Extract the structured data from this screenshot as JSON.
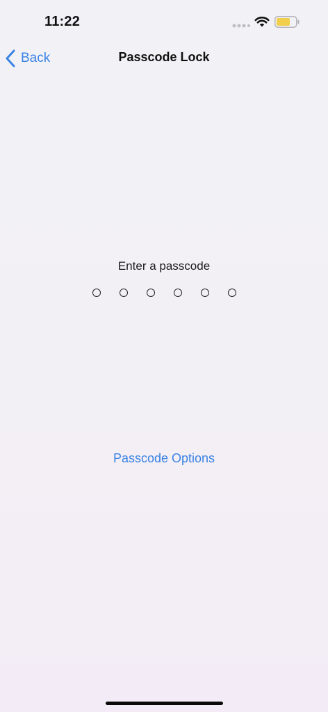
{
  "status_bar": {
    "time": "11:22",
    "icons": {
      "signal": "cellular-signal-icon",
      "wifi": "wifi-icon",
      "battery": "battery-icon"
    },
    "battery_color": "#f2cf4a"
  },
  "nav": {
    "back_label": "Back",
    "back_icon": "chevron-left-icon",
    "title": "Passcode Lock"
  },
  "passcode": {
    "prompt": "Enter a passcode",
    "digits": 6,
    "entered": 0
  },
  "options_label": "Passcode Options",
  "colors": {
    "accent": "#3a82e4",
    "text": "#111111"
  }
}
